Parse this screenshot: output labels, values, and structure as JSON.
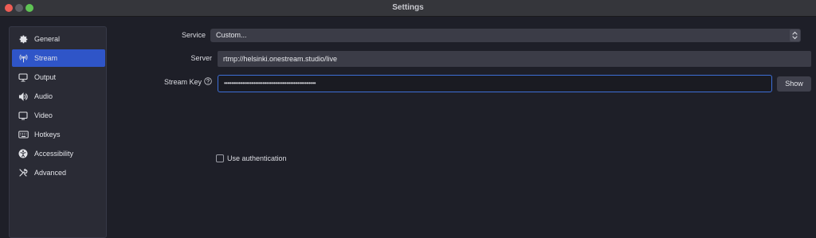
{
  "window": {
    "title": "Settings",
    "traffic_lights": [
      "close",
      "minimize",
      "maximize"
    ]
  },
  "sidebar": {
    "items": [
      {
        "label": "General",
        "icon": "gear-icon",
        "active": false
      },
      {
        "label": "Stream",
        "icon": "broadcast-antenna-icon",
        "active": true
      },
      {
        "label": "Output",
        "icon": "output-icon",
        "active": false
      },
      {
        "label": "Audio",
        "icon": "speaker-icon",
        "active": false
      },
      {
        "label": "Video",
        "icon": "monitor-icon",
        "active": false
      },
      {
        "label": "Hotkeys",
        "icon": "keyboard-icon",
        "active": false
      },
      {
        "label": "Accessibility",
        "icon": "accessibility-icon",
        "active": false
      },
      {
        "label": "Advanced",
        "icon": "tools-icon",
        "active": false
      }
    ]
  },
  "stream": {
    "service": {
      "label": "Service",
      "value": "Custom..."
    },
    "server": {
      "label": "Server",
      "value": "rtmp://helsinki.onestream.studio/live"
    },
    "stream_key": {
      "label": "Stream Key",
      "value": "••••••••••••••••••••••••••••••••••••••••••••••••••",
      "show_label": "Show"
    },
    "use_authentication": {
      "label": "Use authentication",
      "checked": false
    }
  },
  "colors": {
    "background": "#1e1f28",
    "accent": "#2f55c8",
    "focus_border": "#3d6fd8"
  }
}
